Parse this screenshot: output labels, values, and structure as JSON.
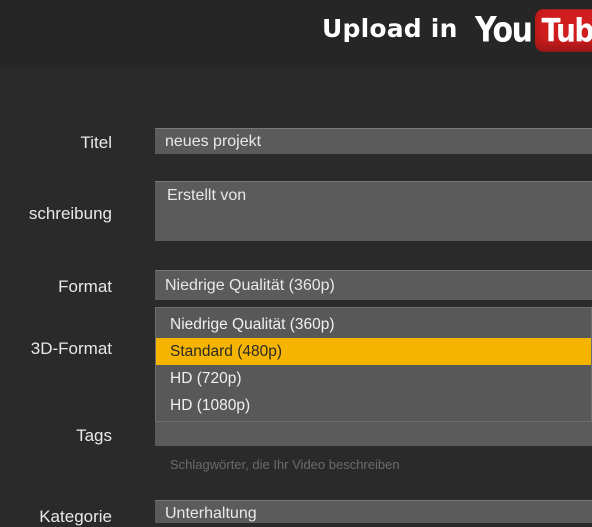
{
  "header": {
    "title": "Upload in",
    "logo_you": "You",
    "logo_tube": "Tube"
  },
  "form": {
    "title_label": "Titel",
    "title_value": "neues projekt",
    "description_label": "schreibung",
    "description_value": "Erstellt von",
    "format_label": "Format",
    "format_value": "Niedrige Qualität (360p)",
    "format_options": [
      "Niedrige Qualität (360p)",
      "Standard (480p)",
      "HD (720p)",
      "HD (1080p)"
    ],
    "selected_option_index": 1,
    "format3d_label": "3D-Format",
    "tags_label": "Tags",
    "tags_hint": "Schlagwörter, die Ihr Video beschreiben",
    "category_label": "Kategorie",
    "category_value": "Unterhaltung"
  },
  "colors": {
    "background": "#2a2a2a",
    "field": "#5b5b5b",
    "highlight": "#f4b400",
    "youtube_red": "#d11d1d"
  }
}
